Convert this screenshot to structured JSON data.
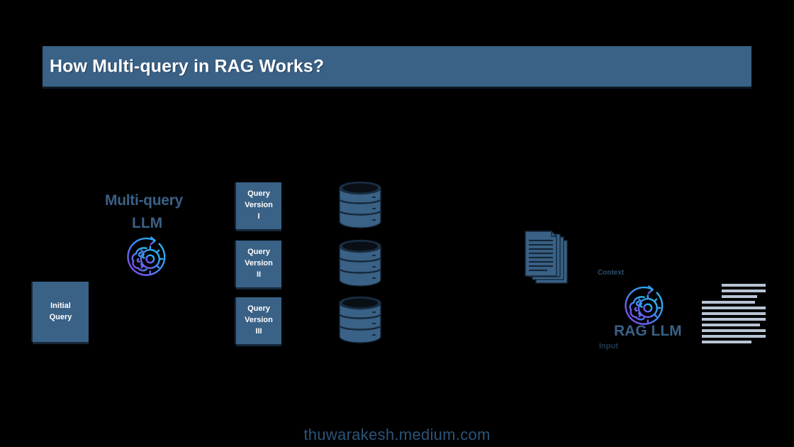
{
  "title": {
    "text": "How Multi-query in RAG Works?",
    "bar_color": "#3a6186",
    "text_color": "#ffffff"
  },
  "background_color": "#000000",
  "accent_color": "#3a6186",
  "gradient": {
    "from": "#22c3f0",
    "to": "#8b3fe8"
  },
  "nodes": {
    "initial_query": {
      "label": "Initial\nQuery",
      "line1": "Initial",
      "line2": "Query"
    },
    "multiquery_llm": {
      "label_line1": "Multi-query",
      "label_line2": "LLM",
      "icon": "brain-gear-refresh-icon"
    },
    "query_versions": [
      {
        "line1": "Query",
        "line2": "Version",
        "line3": "I"
      },
      {
        "line1": "Query",
        "line2": "Version",
        "line3": "II"
      },
      {
        "line1": "Query",
        "line2": "Version",
        "line3": "III"
      }
    ],
    "databases": [
      {
        "name": "database-cylinder-1"
      },
      {
        "name": "database-cylinder-2"
      },
      {
        "name": "database-cylinder-3"
      }
    ],
    "documents": {
      "name": "document-stack-icon",
      "count": 4
    },
    "rag_llm": {
      "label": "RAG LLM",
      "context_label": "Context",
      "input_label": "Input",
      "icon": "brain-gear-refresh-icon"
    },
    "output": {
      "name": "output-text-lines",
      "line_count": 11
    }
  },
  "watermark": {
    "text": "thuwarakesh.medium.com",
    "color": "#2f5a80"
  }
}
